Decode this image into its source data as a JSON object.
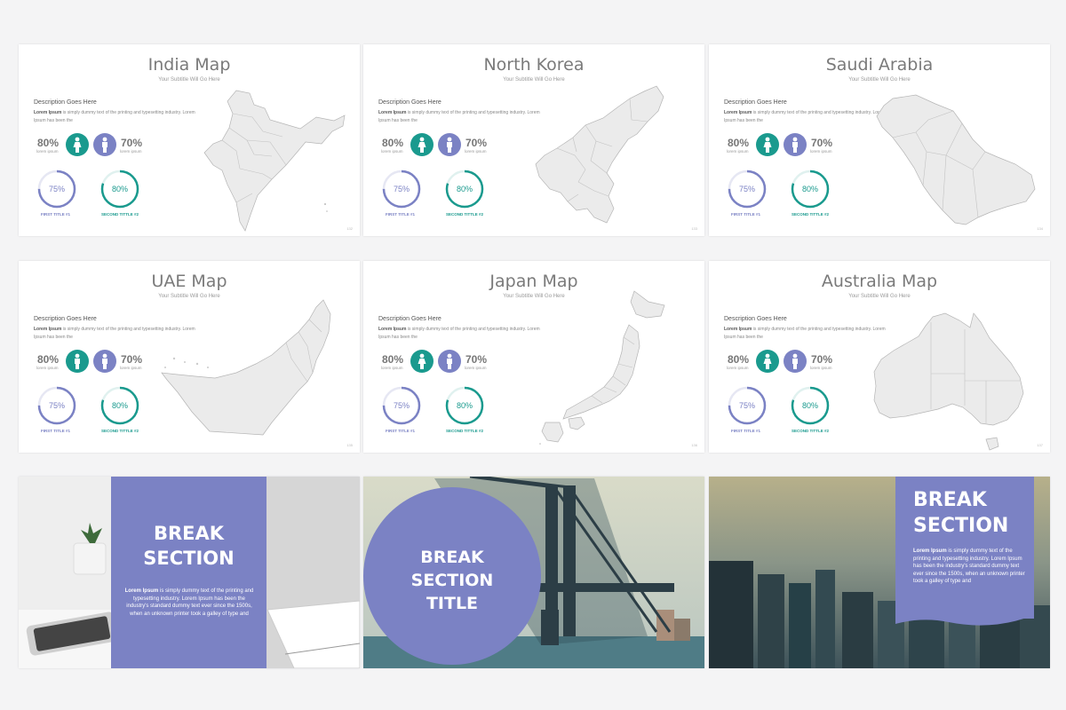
{
  "colors": {
    "purple": "#7b82c4",
    "teal": "#1a9a8e",
    "map_fill": "#ebebeb",
    "map_stroke": "#bbbbbb"
  },
  "map_slides": [
    {
      "title": "India Map",
      "subtitle": "Your Subtitle Will Go Here",
      "description_heading": "Description Goes Here",
      "description_bold": "Lorem Ipsum",
      "description_text": " is simply dummy text of the printing and typesetting industry. Lorem Ipsum has been the",
      "stat_left": "80%",
      "stat_left_sub": "lorem ipsum",
      "stat_right": "70%",
      "stat_right_sub": "lorem ipsum",
      "ring1_value": "75%",
      "ring1_percent": 75,
      "ring1_label": "FIRST TITLE #1",
      "ring2_value": "80%",
      "ring2_percent": 80,
      "ring2_label": "SECOND TITTLE #2",
      "page": "132",
      "female_icon": "female-person-icon",
      "male_icon": "male-person-icon",
      "map_name": "india-map"
    },
    {
      "title": "North Korea",
      "subtitle": "Your Subtitle Will Go Here",
      "description_heading": "Description Goes Here",
      "description_bold": "Lorem Ipsum",
      "description_text": " is simply dummy text of the printing and typesetting industry. Lorem Ipsum has been the",
      "stat_left": "80%",
      "stat_left_sub": "lorem ipsum",
      "stat_right": "70%",
      "stat_right_sub": "lorem ipsum",
      "ring1_value": "75%",
      "ring1_percent": 75,
      "ring1_label": "FIRST TITLE #1",
      "ring2_value": "80%",
      "ring2_percent": 80,
      "ring2_label": "SECOND TITTLE #2",
      "page": "133",
      "female_icon": "female-person-icon",
      "male_icon": "male-person-icon",
      "map_name": "north-korea-map"
    },
    {
      "title": "Saudi Arabia",
      "subtitle": "Your Subtitle Will Go Here",
      "description_heading": "Description Goes Here",
      "description_bold": "Lorem Ipsum",
      "description_text": " is simply dummy text of the printing and typesetting industry. Lorem Ipsum has been the",
      "stat_left": "80%",
      "stat_left_sub": "lorem ipsum",
      "stat_right": "70%",
      "stat_right_sub": "lorem ipsum",
      "ring1_value": "75%",
      "ring1_percent": 75,
      "ring1_label": "FIRST TITLE #1",
      "ring2_value": "80%",
      "ring2_percent": 80,
      "ring2_label": "SECOND TITTLE #2",
      "page": "134",
      "female_icon": "female-person-icon",
      "male_icon": "male-person-icon",
      "map_name": "saudi-arabia-map"
    },
    {
      "title": "UAE Map",
      "subtitle": "Your Subtitle Will Go Here",
      "description_heading": "Description Goes Here",
      "description_bold": "Lorem Ipsum",
      "description_text": " is simply dummy text of the printing and typesetting industry. Lorem Ipsum has been the",
      "stat_left": "80%",
      "stat_left_sub": "lorem ipsum",
      "stat_right": "70%",
      "stat_right_sub": "lorem ipsum",
      "ring1_value": "75%",
      "ring1_percent": 75,
      "ring1_label": "FIRST TITLE #1",
      "ring2_value": "80%",
      "ring2_percent": 80,
      "ring2_label": "SECOND TITTLE #2",
      "page": "135",
      "female_icon": "male-person-icon",
      "male_icon": "male-person-icon",
      "map_name": "uae-map"
    },
    {
      "title": "Japan Map",
      "subtitle": "Your Subtitle Will Go Here",
      "description_heading": "Description Goes Here",
      "description_bold": "Lorem Ipsum",
      "description_text": " is simply dummy text of the printing and typesetting industry. Lorem Ipsum has been the",
      "stat_left": "80%",
      "stat_left_sub": "lorem ipsum",
      "stat_right": "70%",
      "stat_right_sub": "lorem ipsum",
      "ring1_value": "75%",
      "ring1_percent": 75,
      "ring1_label": "FIRST TITLE #1",
      "ring2_value": "80%",
      "ring2_percent": 80,
      "ring2_label": "SECOND TITTLE #2",
      "page": "136",
      "female_icon": "female-person-icon",
      "male_icon": "male-person-icon",
      "map_name": "japan-map"
    },
    {
      "title": "Australia Map",
      "subtitle": "Your Subtitle Will Go Here",
      "description_heading": "Description Goes Here",
      "description_bold": "Lorem Ipsum",
      "description_text": " is simply dummy text of the printing and typesetting industry. Lorem Ipsum has been the",
      "stat_left": "80%",
      "stat_left_sub": "lorem ipsum",
      "stat_right": "70%",
      "stat_right_sub": "lorem ipsum",
      "ring1_value": "75%",
      "ring1_percent": 75,
      "ring1_label": "FIRST TITLE #1",
      "ring2_value": "80%",
      "ring2_percent": 80,
      "ring2_label": "SECOND TITTLE #2",
      "page": "137",
      "female_icon": "female-person-icon",
      "male_icon": "male-person-icon",
      "map_name": "australia-map"
    }
  ],
  "break_slides": [
    {
      "title_line1": "BREAK",
      "title_line2": "SECTION",
      "text_bold": "Lorem Ipsum",
      "text_rest": " is simply dummy text of the printing and typesetting industry. Lorem Ipsum has been the industry's standard dummy text ever since the 1500s, when an unknown printer took a galley of type and",
      "image_name": "desk-phone-notebook-photo"
    },
    {
      "title_line1": "BREAK",
      "title_line2": "SECTION",
      "title_line3": "TITLE",
      "image_name": "bridge-photo"
    },
    {
      "title_line1": "BREAK",
      "title_line2": "SECTION",
      "text_bold": "Lorem Ipsum",
      "text_rest": " is simply dummy text of the printing and typesetting industry. Lorem Ipsum has been the industry's standard dummy text ever since the 1500s, when an unknown printer took a galley of type and",
      "image_name": "city-skyline-photo"
    }
  ]
}
